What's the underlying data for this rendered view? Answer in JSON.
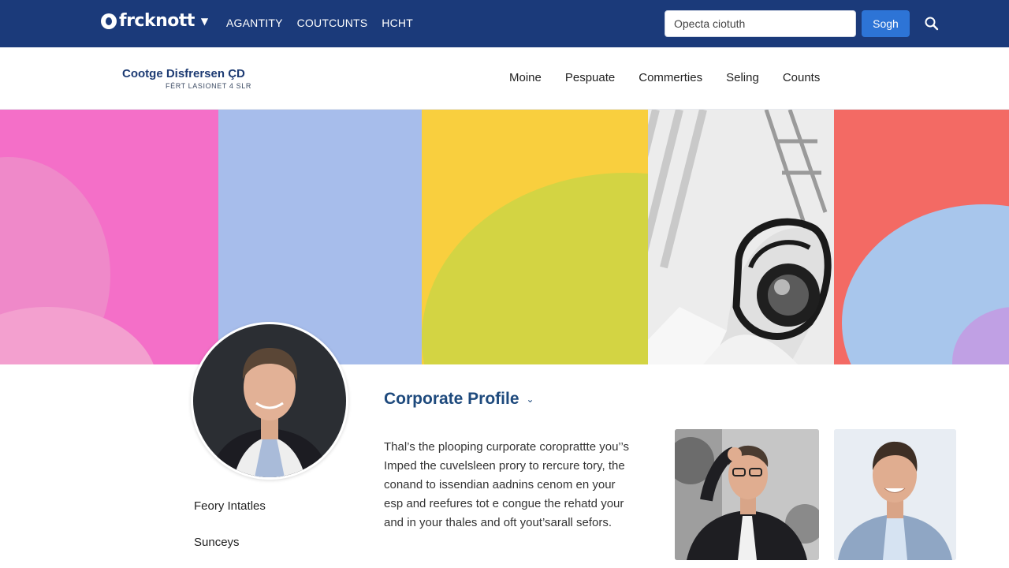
{
  "topbar": {
    "logo_text": "frcknott",
    "logo_icon": "brand-logo-icon",
    "nav": [
      "AGANTITY",
      "COUTCUNTS",
      "HCHT"
    ],
    "search": {
      "value": "Opecta ciotuth",
      "button_label": "Sogh"
    },
    "colors": {
      "bar": "#1b3a7a",
      "button": "#2d74d6"
    }
  },
  "subheader": {
    "brand_title": "Cootge Disfrersen ÇD",
    "brand_subtitle": "FÉRT LASIONET 4 SLR",
    "nav": [
      "Moine",
      "Pespuate",
      "Commerties",
      "Seling",
      "Counts"
    ]
  },
  "hero": {
    "panel_colors": [
      "#f46fc8",
      "#a7bdeb",
      "#f9cf3e",
      "#e9e9e9",
      "#f36a64"
    ]
  },
  "profile": {
    "side_links": [
      "Feory Intatles",
      "Sunceys"
    ],
    "section_title": "Corporate Profile",
    "bio_lines": [
      "Thal’s the plooping curporate coroprattte you’’s",
      "Imped the cuvelsleen prory to rercure tory, the",
      "conand to issendian aadnins cenom en your",
      "esp and reefures tot e congue the rehatd your",
      "and in your thales and oft yout’sarall sefors."
    ]
  }
}
